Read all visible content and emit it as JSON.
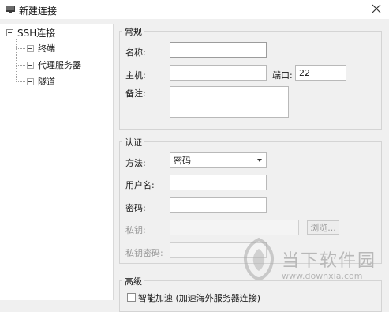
{
  "window": {
    "title": "新建连接"
  },
  "tree": {
    "root": {
      "label": "SSH连接"
    },
    "children": [
      {
        "label": "终端"
      },
      {
        "label": "代理服务器"
      },
      {
        "label": "隧道"
      }
    ]
  },
  "general": {
    "legend": "常规",
    "name_label": "名称:",
    "name_value": "",
    "host_label": "主机:",
    "host_value": "",
    "port_label": "端口:",
    "port_value": "22",
    "note_label": "备注:",
    "note_value": ""
  },
  "auth": {
    "legend": "认证",
    "method_label": "方法:",
    "method_value": "密码",
    "username_label": "用户名:",
    "username_value": "",
    "password_label": "密码:",
    "password_value": "",
    "private_key_label": "私钥:",
    "private_key_value": "",
    "browse_label": "浏览...",
    "key_password_label": "私钥密码:",
    "key_password_value": ""
  },
  "advanced": {
    "legend": "高级",
    "accel_label": "智能加速 (加速海外服务器连接)",
    "accel_checked": false
  },
  "watermark": {
    "brand": "当下软件园",
    "url": "www.downxia.com"
  }
}
